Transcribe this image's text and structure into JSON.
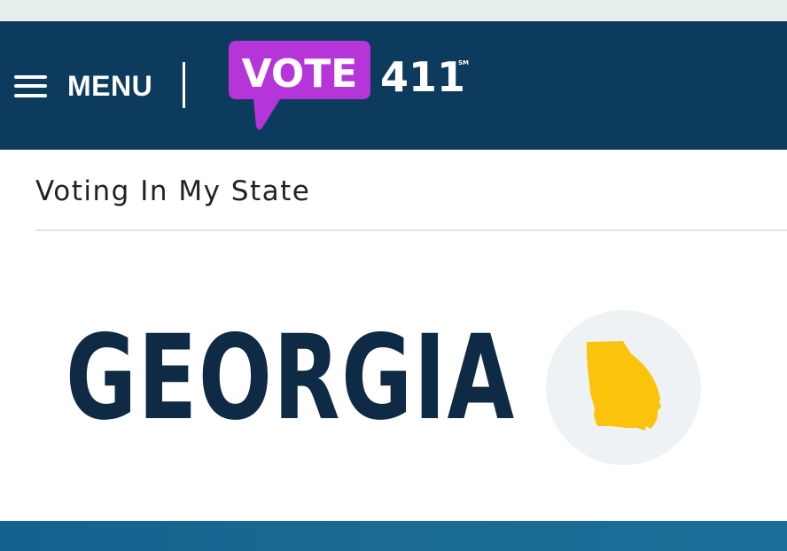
{
  "header": {
    "menu_label": "MENU",
    "logo": {
      "word": "VOTE",
      "number": "411",
      "mark": "SM"
    }
  },
  "main": {
    "page_title": "Voting In My State",
    "state_name": "GEORGIA",
    "state_icon": "georgia-state-map-icon"
  },
  "colors": {
    "header_bg": "#0c3b5d",
    "logo_purple": "#b535d9",
    "state_text": "#0e2a44",
    "state_map": "#fbc30b",
    "circle_bg": "#eef2f5",
    "footer": "#14628e"
  }
}
